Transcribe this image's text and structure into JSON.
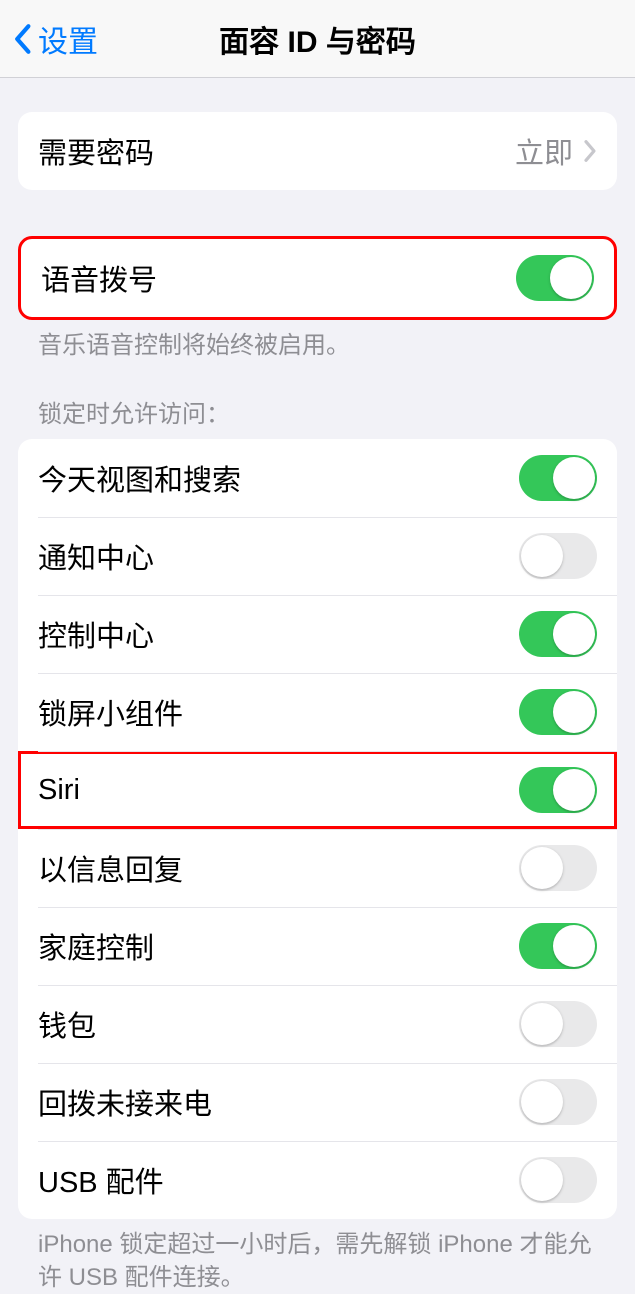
{
  "header": {
    "back_label": "设置",
    "title": "面容 ID 与密码"
  },
  "passcode": {
    "require_label": "需要密码",
    "require_value": "立即"
  },
  "voice_dial": {
    "label": "语音拨号",
    "on": true,
    "footer": "音乐语音控制将始终被启用。"
  },
  "locked_access": {
    "header": "锁定时允许访问：",
    "items": [
      {
        "label": "今天视图和搜索",
        "on": true,
        "name": "toggle-today-view"
      },
      {
        "label": "通知中心",
        "on": false,
        "name": "toggle-notification-center"
      },
      {
        "label": "控制中心",
        "on": true,
        "name": "toggle-control-center"
      },
      {
        "label": "锁屏小组件",
        "on": true,
        "name": "toggle-lock-screen-widgets"
      },
      {
        "label": "Siri",
        "on": true,
        "name": "toggle-siri",
        "highlight": true
      },
      {
        "label": "以信息回复",
        "on": false,
        "name": "toggle-reply-with-message"
      },
      {
        "label": "家庭控制",
        "on": true,
        "name": "toggle-home-control"
      },
      {
        "label": "钱包",
        "on": false,
        "name": "toggle-wallet"
      },
      {
        "label": "回拨未接来电",
        "on": false,
        "name": "toggle-return-missed-calls"
      },
      {
        "label": "USB 配件",
        "on": false,
        "name": "toggle-usb-accessories"
      }
    ],
    "footer": "iPhone 锁定超过一小时后，需先解锁 iPhone 才能允许 USB 配件连接。"
  }
}
